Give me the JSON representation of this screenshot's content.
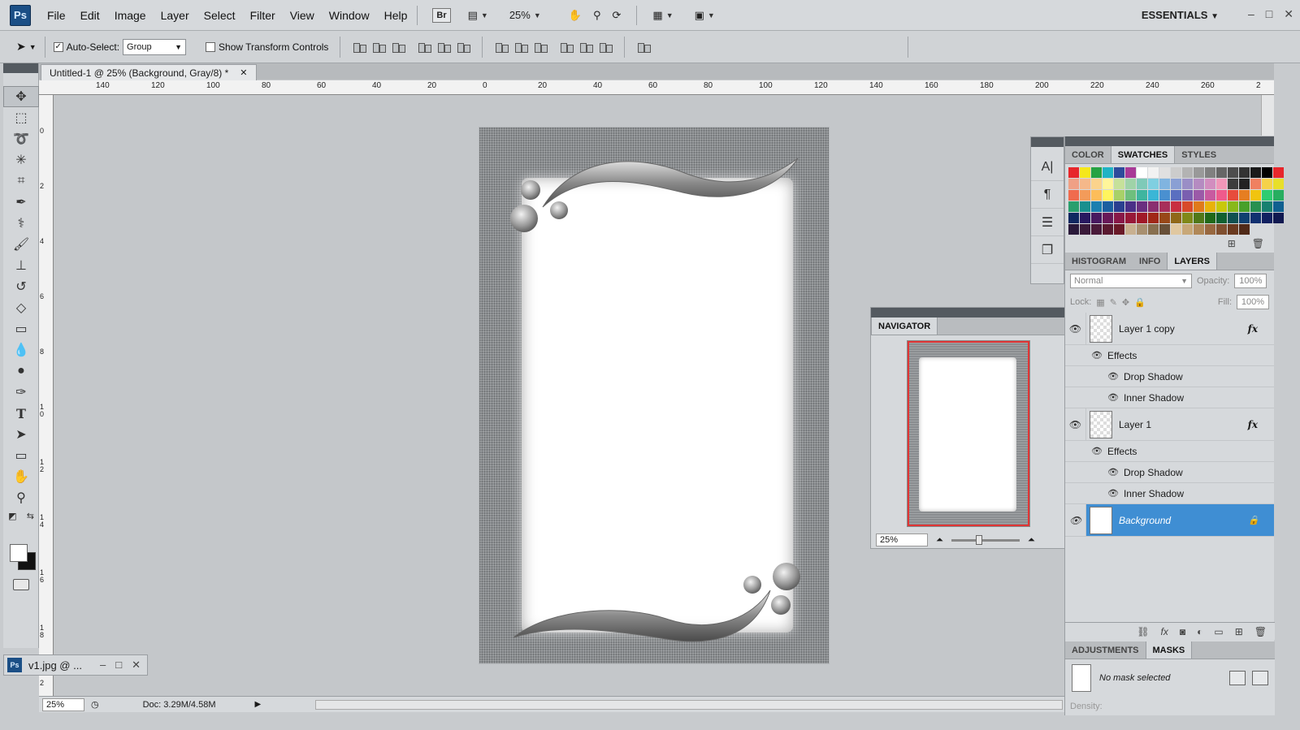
{
  "app": {
    "logo": "Ps",
    "workspace": "ESSENTIALS"
  },
  "menu": [
    "File",
    "Edit",
    "Image",
    "Layer",
    "Select",
    "Filter",
    "View",
    "Window",
    "Help"
  ],
  "toolbar_top": {
    "br_label": "Br",
    "zoom": "25%"
  },
  "options": {
    "auto_select_label": "Auto-Select:",
    "auto_select_checked": true,
    "group_value": "Group",
    "transform_label": "Show Transform Controls"
  },
  "document": {
    "tab_title": "Untitled-1 @ 25% (Background, Gray/8) *"
  },
  "ruler_top": [
    "140",
    "120",
    "100",
    "80",
    "60",
    "40",
    "20",
    "0",
    "20",
    "40",
    "60",
    "80",
    "100",
    "120",
    "140",
    "160",
    "180",
    "200",
    "220",
    "240",
    "260",
    "2"
  ],
  "ruler_left": [
    "0",
    "2",
    "4",
    "6",
    "8",
    "10",
    "12",
    "14",
    "16",
    "18",
    "2"
  ],
  "mini_window": {
    "icon": "Ps",
    "title": "v1.jpg @ ..."
  },
  "status": {
    "zoom": "25%",
    "doc": "Doc: 3.29M/4.58M"
  },
  "swatches_panel": {
    "tabs": [
      "COLOR",
      "SWATCHES",
      "STYLES"
    ],
    "active": "SWATCHES"
  },
  "swatch_colors": [
    "#e7262b",
    "#f5e71b",
    "#26a243",
    "#1fb3c4",
    "#2e4b9b",
    "#a83a97",
    "#ffffff",
    "#f2f2f2",
    "#e0e0e0",
    "#cccccc",
    "#b3b3b3",
    "#999999",
    "#808080",
    "#666666",
    "#4d4d4d",
    "#333333",
    "#1a1a1a",
    "#000000",
    "#e7262b",
    "#f0a085",
    "#f5b88a",
    "#fbd38c",
    "#fff59a",
    "#c6e19a",
    "#9fd3a8",
    "#7ecab8",
    "#7fcfe1",
    "#80b4e0",
    "#8a9fd4",
    "#9a8ec6",
    "#b58bc1",
    "#d28dbf",
    "#f097b9",
    "#3c3c3c",
    "#222222",
    "#f08060",
    "#f5d24a",
    "#e8df2a",
    "#f06b4e",
    "#f39b5a",
    "#fdbd59",
    "#fff45e",
    "#a8d168",
    "#6fbf7d",
    "#3fb59f",
    "#3bb6d6",
    "#4a90d0",
    "#5a6fc0",
    "#7a5fb0",
    "#9b5aa8",
    "#c85aa0",
    "#ef5a8c",
    "#e74c3c",
    "#e67e22",
    "#f1c40f",
    "#2ecc71",
    "#27ae60",
    "#2a9f6e",
    "#1a8f8e",
    "#1b7fb0",
    "#1b5fa0",
    "#2a3f90",
    "#4a2f88",
    "#6a2f80",
    "#8a2f70",
    "#a82f5a",
    "#c82f40",
    "#d84a2a",
    "#e07a1a",
    "#e8b20a",
    "#c8c80a",
    "#88b81a",
    "#48a02a",
    "#289050",
    "#188070",
    "#106090",
    "#102860",
    "#281860",
    "#481860",
    "#681858",
    "#881848",
    "#981838",
    "#a01828",
    "#a02818",
    "#984818",
    "#906818",
    "#808818",
    "#507818",
    "#206818",
    "#106030",
    "#105050",
    "#104070",
    "#103070",
    "#102060",
    "#101850",
    "#2a1a3a",
    "#3a1a3a",
    "#4a1a3a",
    "#5a1a30",
    "#6a1a28",
    "#c8b090",
    "#a89070",
    "#887050",
    "#685038",
    "#e0c8a0",
    "#c8a878",
    "#b08858",
    "#986840",
    "#805030",
    "#6a3a20",
    "#502a18"
  ],
  "layers_panel": {
    "tabs": [
      "HISTOGRAM",
      "INFO",
      "LAYERS"
    ],
    "active": "LAYERS",
    "blend_mode": "Normal",
    "opacity_label": "Opacity:",
    "opacity": "100%",
    "lock_label": "Lock:",
    "fill_label": "Fill:",
    "fill": "100%"
  },
  "layers": [
    {
      "name": "Layer 1 copy",
      "effects_label": "Effects",
      "effects": [
        "Drop Shadow",
        "Inner Shadow"
      ]
    },
    {
      "name": "Layer 1",
      "effects_label": "Effects",
      "effects": [
        "Drop Shadow",
        "Inner Shadow"
      ]
    },
    {
      "name": "Background"
    }
  ],
  "masks_panel": {
    "tabs": [
      "ADJUSTMENTS",
      "MASKS"
    ],
    "active": "MASKS",
    "message": "No mask selected",
    "density_label": "Density:"
  },
  "navigator": {
    "title": "NAVIGATOR",
    "zoom": "25%"
  }
}
